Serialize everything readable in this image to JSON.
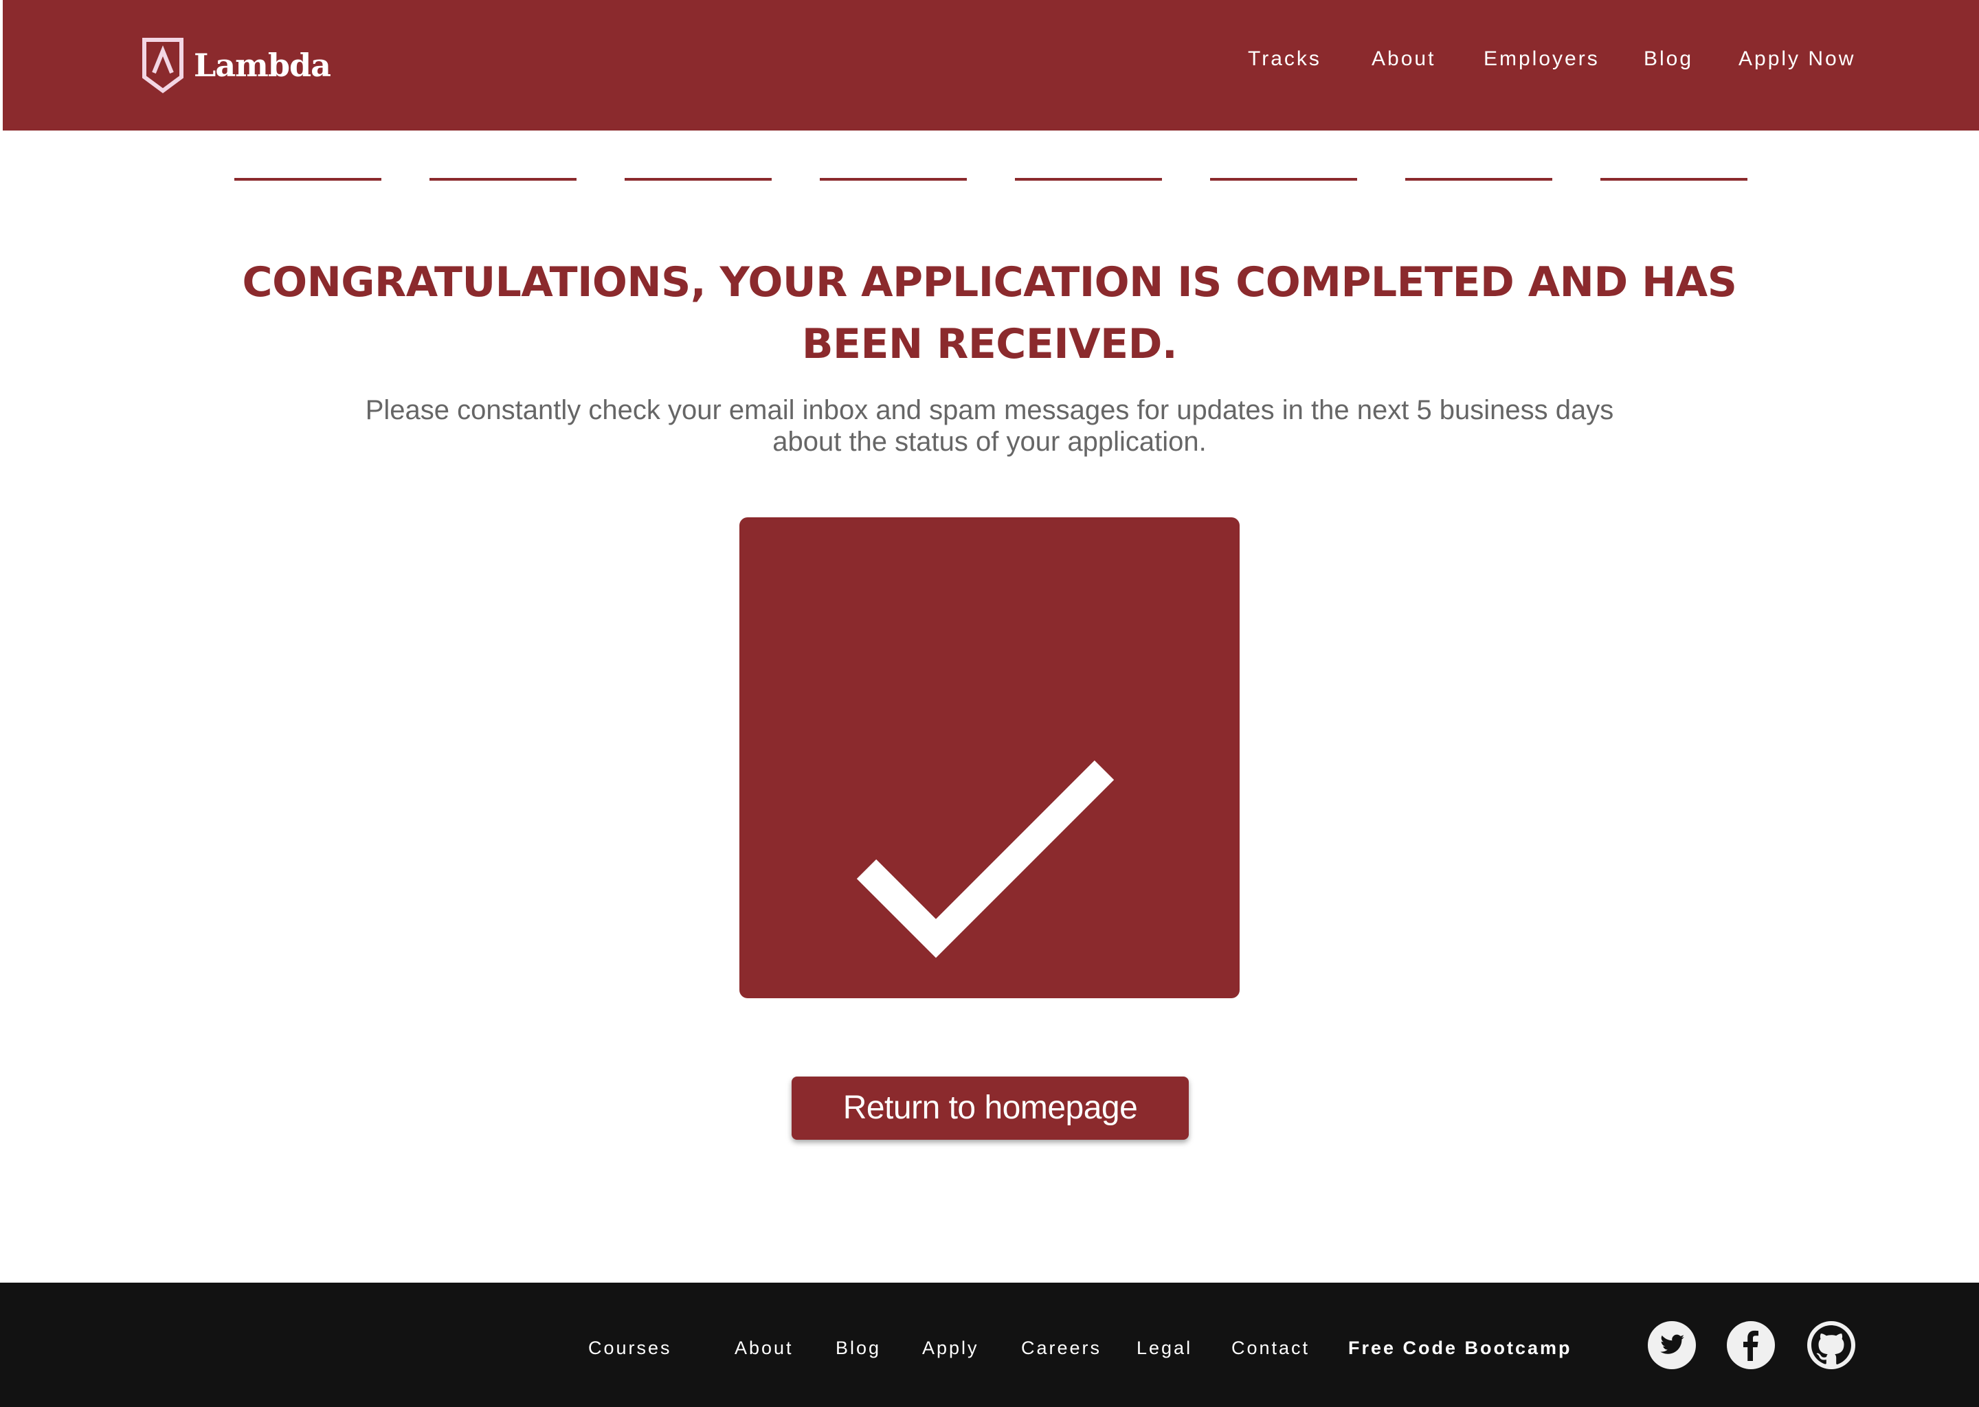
{
  "header": {
    "logo_text": "Lambda",
    "nav": [
      "Tracks",
      "About",
      "Employers",
      "Blog",
      "Apply Now"
    ]
  },
  "progress": {
    "segments": 8
  },
  "main": {
    "title": "CONGRATULATIONS, YOUR APPLICATION IS COMPLETED AND HAS BEEN RECEIVED.",
    "message": "Please constantly check your email inbox and spam messages for updates in the next 5 business days about the status of your application.",
    "success_icon": "checkmark-icon",
    "return_button": "Return to homepage"
  },
  "footer": {
    "links": [
      "Courses",
      "About",
      "Blog",
      "Apply",
      "Careers",
      "Legal",
      "Contact",
      "Free Code Bootcamp"
    ],
    "social": [
      "twitter-icon",
      "facebook-icon",
      "github-icon"
    ]
  },
  "colors": {
    "brand": "#8b2a2d",
    "footer_bg": "#121212",
    "text_muted": "#666666"
  }
}
